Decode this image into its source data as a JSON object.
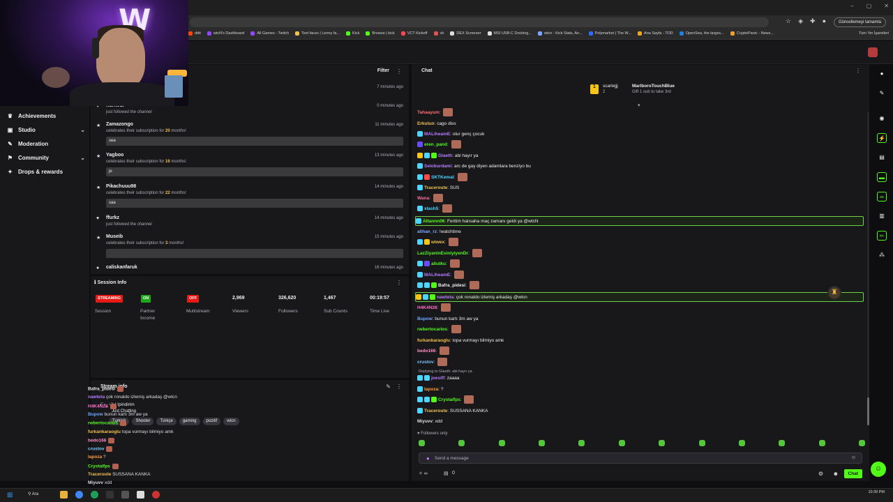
{
  "browser": {
    "update_button": "Güncellemeyi tamamla",
    "bookmarks": [
      {
        "label": "ddit",
        "color": "#ff4500"
      },
      {
        "label": "wtcN's Dashboard",
        "color": "#9146ff"
      },
      {
        "label": "All Games - Twitch",
        "color": "#9146ff"
      },
      {
        "label": "Text faces | Lenny fa...",
        "color": "#f0c14b"
      },
      {
        "label": "Kick",
        "color": "#53fc18"
      },
      {
        "label": "Browse | kick",
        "color": "#53fc18"
      },
      {
        "label": "VCT Kickoff",
        "color": "#ff4655"
      },
      {
        "label": "vlr",
        "color": "#e05252"
      },
      {
        "label": "DEX Screener",
        "color": "#dddddd"
      },
      {
        "label": "MSI USB-C Docking...",
        "color": "#e0e0e0"
      },
      {
        "label": "wtcn - Kick Stats, An...",
        "color": "#7aa8ff"
      },
      {
        "label": "Polymarket | The W...",
        "color": "#2d6cff"
      },
      {
        "label": "Ana Sayfa - TOD",
        "color": "#f5a623"
      },
      {
        "label": "OpenSea, the larges...",
        "color": "#2081e2"
      },
      {
        "label": "CryptoPanic - News...",
        "color": "#f0a030"
      }
    ],
    "other_bookmarks": "Tüm Yer İşaretleri"
  },
  "left_nav": {
    "items": [
      {
        "label": "Achievements",
        "icon": "trophy-icon",
        "glyph": "♛",
        "chevron": false
      },
      {
        "label": "Studio",
        "icon": "studio-icon",
        "glyph": "▣",
        "chevron": true
      },
      {
        "label": "Moderation",
        "icon": "wrench-icon",
        "glyph": "✎",
        "chevron": false
      },
      {
        "label": "Community",
        "icon": "community-icon",
        "glyph": "⚑",
        "chevron": true
      },
      {
        "label": "Drops & rewards",
        "icon": "gift-icon",
        "glyph": "✦",
        "chevron": false
      }
    ]
  },
  "feed": {
    "filter_label": "Filter",
    "items": [
      {
        "name": "",
        "pre": "",
        "num": "",
        "post": "",
        "time": "7 minutes ago",
        "msg": "",
        "icon": ""
      },
      {
        "name": "hurheur",
        "pre": "just followed the channel",
        "num": "",
        "post": "",
        "time": "0 minutes ago",
        "msg": "",
        "icon": "♥"
      },
      {
        "name": "Zamazongo",
        "pre": "celebrates their subscription for ",
        "num": "20",
        "post": " months!",
        "time": "11 minutes ago",
        "msg": "sea",
        "icon": "★"
      },
      {
        "name": "Yagboo",
        "pre": "celebrates their subscription for ",
        "num": "16",
        "post": " months!",
        "time": "13 minutes ago",
        "msg": "je",
        "icon": "★"
      },
      {
        "name": "Pikachuuu98",
        "pre": "celebrates their subscription for ",
        "num": "22",
        "post": " months!",
        "time": "14 minutes ago",
        "msg": "saa",
        "icon": "★"
      },
      {
        "name": "ffurkz",
        "pre": "just followed the channel",
        "num": "",
        "post": "",
        "time": "14 minutes ago",
        "msg": "",
        "icon": "♥"
      },
      {
        "name": "Museib",
        "pre": "celebrates their subscription for ",
        "num": "3",
        "post": " months!",
        "time": "15 minutes ago",
        "msg": " ",
        "icon": "★"
      },
      {
        "name": "caliskanfaruk",
        "pre": "",
        "num": "",
        "post": "",
        "time": "16 minutes ago",
        "msg": "",
        "icon": "●"
      }
    ]
  },
  "session": {
    "title": "Session Info",
    "cols": [
      {
        "badge": "STREAMING",
        "badge_color": "#e91916",
        "value": "",
        "label": "Session"
      },
      {
        "badge": "ON",
        "badge_color": "#1fa81c",
        "value": "",
        "label": "Partner\nIncome"
      },
      {
        "badge": "OFF",
        "badge_color": "#e91916",
        "value": "",
        "label": "Multistream"
      },
      {
        "badge": "",
        "badge_color": "",
        "value": "2,969",
        "label": "Viewers"
      },
      {
        "badge": "",
        "badge_color": "",
        "value": "326,620",
        "label": "Followers"
      },
      {
        "badge": "",
        "badge_color": "",
        "value": "1,467",
        "label": "Sub Counts"
      },
      {
        "badge": "",
        "badge_color": "",
        "value": "00:19:57",
        "label": "Time Live"
      }
    ]
  },
  "stream_info": {
    "title": "Stream info",
    "subtitle": "(´･_･`) | !pindirim",
    "category": "Just Chatting",
    "tags": [
      "Turkish",
      "Shooter",
      "Türkçe",
      "gaming",
      "pozitif",
      "wtcn"
    ]
  },
  "ghost_chat": [
    {
      "user": "Bafra_pidesi",
      "color": "#e8e8e8",
      "text": "",
      "emote": true
    },
    {
      "user": "nawteta",
      "color": "#b57cff",
      "text": "çok ronaldo izlemiş arkadaş @wtcn",
      "emote": false
    },
    {
      "user": "H4K4N28",
      "color": "#ff6ec7",
      "text": "",
      "emote": true
    },
    {
      "user": "Bupow",
      "color": "#6aa8ff",
      "text": "bunun kartı 3m aw ya",
      "emote": false
    },
    {
      "user": "rwbertocarlos",
      "color": "#53fc18",
      "text": "",
      "emote": true
    },
    {
      "user": "furkankaraoglu",
      "color": "#f0c14b",
      "text": "topa vurmayı bilmiyo amk",
      "emote": false
    },
    {
      "user": "bedo166",
      "color": "#ff8ec7",
      "text": "",
      "emote": true
    },
    {
      "user": "crustov",
      "color": "#7ac7ff",
      "text": "",
      "emote": true
    },
    {
      "user": "lapoza",
      "color": "#ff9b3a",
      "text": "?",
      "emote": false
    },
    {
      "user": "Crystalfps",
      "color": "#53fc18",
      "text": "",
      "emote": true
    },
    {
      "user": "Traceroute",
      "color": "#f0c14b",
      "text": "SUSSANA KANKA",
      "emote": false
    },
    {
      "user": "Miyuvv",
      "color": "#dedee3",
      "text": "xdd",
      "emote": false
    }
  ],
  "chat": {
    "title": "Chat",
    "gift": {
      "user": "scarlejjj",
      "count": "2",
      "name": "MarlboroTouchBlue",
      "name_count": "1",
      "subtitle": "Gift 1 sub to take 3rd"
    },
    "messages": [
      {
        "user": "Tahaayum",
        "color": "#ff6e6e",
        "text": "",
        "emote": true,
        "hl": false,
        "badges": []
      },
      {
        "user": "Erkutun",
        "color": "#f0c14b",
        "text": "cago diss",
        "emote": false,
        "hl": false,
        "badges": []
      },
      {
        "user": "MALiheamE",
        "color": "#b57cff",
        "text": "olur genç çocuk",
        "emote": false,
        "hl": false,
        "badges": [
          "#4bd5ff"
        ]
      },
      {
        "user": "eren_pand",
        "color": "#53fc18",
        "text": "",
        "emote": true,
        "hl": false,
        "badges": [
          "#6b4bff"
        ]
      },
      {
        "user": "Glaeth",
        "color": "#b57cff",
        "text": "abi hayır ya",
        "emote": false,
        "hl": false,
        "badges": [
          "#f5c518",
          "#4bd5ff",
          "#53fc18"
        ]
      },
      {
        "user": "Seloburdami",
        "color": "#b57cff",
        "text": "arc de gay diyen adamlara benziyo bu",
        "emote": false,
        "hl": false,
        "badges": [
          "#4bd5ff"
        ]
      },
      {
        "user": "SKTKemal",
        "color": "#4bd5ff",
        "text": "",
        "emote": true,
        "hl": false,
        "badges": [
          "#4bd5ff",
          "#ff4b4b"
        ]
      },
      {
        "user": "Traceroute",
        "color": "#f0c14b",
        "text": "SUS",
        "emote": false,
        "hl": false,
        "badges": [
          "#4bd5ff"
        ]
      },
      {
        "user": "Wana",
        "color": "#ff6e9e",
        "text": "",
        "emote": true,
        "hl": false,
        "badges": []
      },
      {
        "user": "xlash5",
        "color": "#4bd5ff",
        "text": "",
        "emote": true,
        "hl": false,
        "badges": [
          "#4bd5ff"
        ]
      },
      {
        "user": "Altannn06",
        "color": "#53fc18",
        "text": "Feritim halısaha maç zamanı geldi ya @wtcN",
        "emote": false,
        "hl": true,
        "badges": [
          "#4bd5ff"
        ]
      },
      {
        "user": "alihan_rz",
        "color": "#7aa8ff",
        "text": "!watchtime",
        "emote": false,
        "hl": false,
        "badges": []
      },
      {
        "user": "wiwex",
        "color": "#f0c14b",
        "text": "",
        "emote": true,
        "hl": false,
        "badges": [
          "#4bd5ff",
          "#f5c518"
        ]
      },
      {
        "user": "LazZiyaninEsiniyiyenDr",
        "color": "#53fc18",
        "text": "",
        "emote": true,
        "hl": false,
        "badges": []
      },
      {
        "user": "aliutku",
        "color": "#53fc18",
        "text": "",
        "emote": true,
        "hl": false,
        "badges": [
          "#4bd5ff",
          "#6b4bff"
        ]
      },
      {
        "user": "MALiheamE",
        "color": "#b57cff",
        "text": "",
        "emote": true,
        "hl": false,
        "badges": [
          "#4bd5ff"
        ]
      },
      {
        "user": "Bafra_pidesi",
        "color": "#efeff1",
        "text": "",
        "emote": true,
        "hl": false,
        "badges": [
          "#4bd5ff",
          "#4bd5ff",
          "#53fc18"
        ]
      },
      {
        "user": "nawteta",
        "color": "#b57cff",
        "text": "çok ronaldo izlemiş arkadaş @wtcn",
        "emote": false,
        "hl": true,
        "badges": [
          "#f5c518",
          "#4bd5ff",
          "#53fc18"
        ]
      },
      {
        "user": "H4K4N28",
        "color": "#ff6ec7",
        "text": "",
        "emote": true,
        "hl": false,
        "badges": []
      },
      {
        "user": "Bupow",
        "color": "#6aa8ff",
        "text": "bunun kartı 3m aw ya",
        "emote": false,
        "hl": false,
        "badges": []
      },
      {
        "user": "rwbertocarlos",
        "color": "#53fc18",
        "text": "",
        "emote": true,
        "hl": false,
        "badges": []
      },
      {
        "user": "furkankaraoglu",
        "color": "#f0c14b",
        "text": "topa vurmayı bilmiyo amk",
        "emote": false,
        "hl": false,
        "badges": []
      },
      {
        "user": "bedo166",
        "color": "#ff8ec7",
        "text": "",
        "emote": true,
        "hl": false,
        "badges": []
      },
      {
        "user": "crustov",
        "color": "#7ac7ff",
        "text": "",
        "emote": true,
        "hl": false,
        "badges": []
      },
      {
        "user": "joesiff",
        "color": "#b57cff",
        "text": "zaaaa",
        "emote": false,
        "hl": false,
        "badges": [
          "#4bd5ff",
          "#4bd5ff"
        ]
      },
      {
        "user": "lapoza",
        "color": "#ff9b3a",
        "text": "?",
        "emote": false,
        "hl": false,
        "badges": [
          "#4bd5ff"
        ]
      },
      {
        "user": "Crystalfps",
        "color": "#53fc18",
        "text": "",
        "emote": true,
        "hl": false,
        "badges": [
          "#4bd5ff",
          "#4bd5ff",
          "#53fc18"
        ]
      },
      {
        "user": "Traceroute",
        "color": "#f0c14b",
        "text": "SUSSANA KANKA",
        "emote": false,
        "hl": false,
        "badges": [
          "#4bd5ff"
        ]
      },
      {
        "user": "Miyuvv",
        "color": "#dedee3",
        "text": "xdd",
        "emote": false,
        "hl": false,
        "badges": []
      }
    ],
    "reply_context": "Replying to Glaeth: abi hayır ya",
    "followers_only": "Followers only",
    "input_placeholder": "Send a message",
    "send_label": "Chat",
    "footer_count": "0"
  },
  "taskbar": {
    "search_label": "Ara",
    "time": "10:39 PM"
  }
}
